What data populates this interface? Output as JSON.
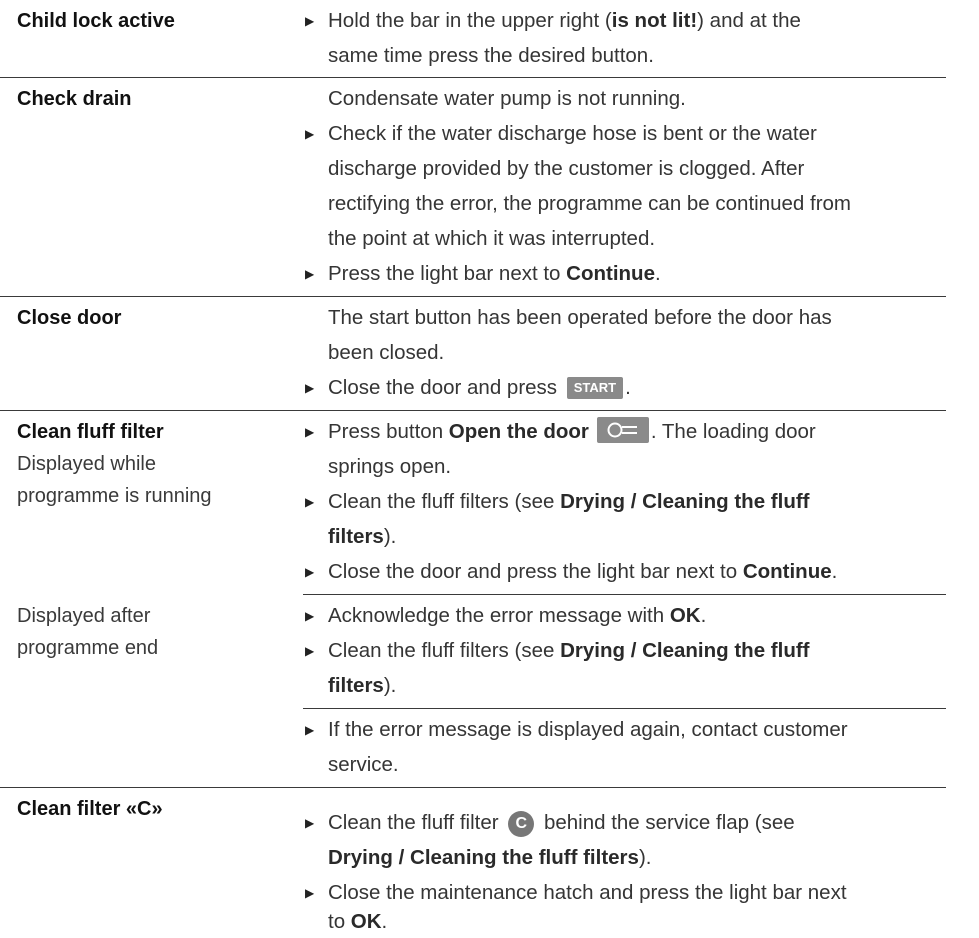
{
  "rows": {
    "child_lock": {
      "label": "Child lock active",
      "l1_pre": "Hold the bar in the upper right (",
      "l1_bold": "is not lit!",
      "l1_post": ") and at the",
      "l2": "same time press the desired button."
    },
    "check_drain": {
      "label": "Check drain",
      "l1": "Condensate water pump is not running.",
      "l2": "Check if the water discharge hose is bent or the water",
      "l3": "discharge provided by the customer is clogged. After",
      "l4": "rectifying the error, the programme can be continued from",
      "l5": "the point at which it was interrupted.",
      "l6_pre": "Press the light bar next to ",
      "l6_bold": "Continue",
      "l6_post": "."
    },
    "close_door": {
      "label": "Close door",
      "l1": "The start button has been operated before the door has",
      "l2": "been closed.",
      "l3_pre": "Close the door and press ",
      "start_label": "START",
      "l3_post": "."
    },
    "clean_fluff": {
      "label": "Clean fluff filter",
      "sub1": "Displayed while programme is running",
      "l1_pre": "Press button ",
      "l1_bold": "Open the door",
      "l1_post": ". The loading door",
      "l2": "springs open.",
      "l3_pre": "Clean the fluff filters (see ",
      "l3_bold": "Drying / Cleaning the fluff",
      "l4_bold": "filters",
      "l4_post": ").",
      "l5_pre": "Close the door and press the light bar next to ",
      "l5_bold": "Continue",
      "l5_post": ".",
      "sub2": "Displayed after programme end",
      "l6_pre": "Acknowledge the error message with ",
      "l6_bold": "OK",
      "l6_post": ".",
      "l7_pre": "Clean the fluff filters (see ",
      "l7_bold": "Drying / Cleaning the fluff",
      "l8_bold": "filters",
      "l8_post": ").",
      "l9": "If the error message is displayed again, contact customer",
      "l10": "service."
    },
    "clean_filter_c": {
      "label": "Clean filter «C»",
      "l1_pre": "Clean the fluff filter ",
      "circle": "C",
      "l1_post": " behind the service flap (see",
      "l2_bold": "Drying / Cleaning the fluff filters",
      "l2_post": ").",
      "l3": "Close the maintenance hatch and press the light bar next",
      "l4_pre": "to ",
      "l4_bold": "OK",
      "l4_post": "."
    }
  },
  "icons": {
    "bullet": "triangle-right-icon",
    "key": "key-icon"
  },
  "colors": {
    "button_bg": "#8a8a8a",
    "text": "#353535",
    "rule": "#3a3a3a"
  }
}
